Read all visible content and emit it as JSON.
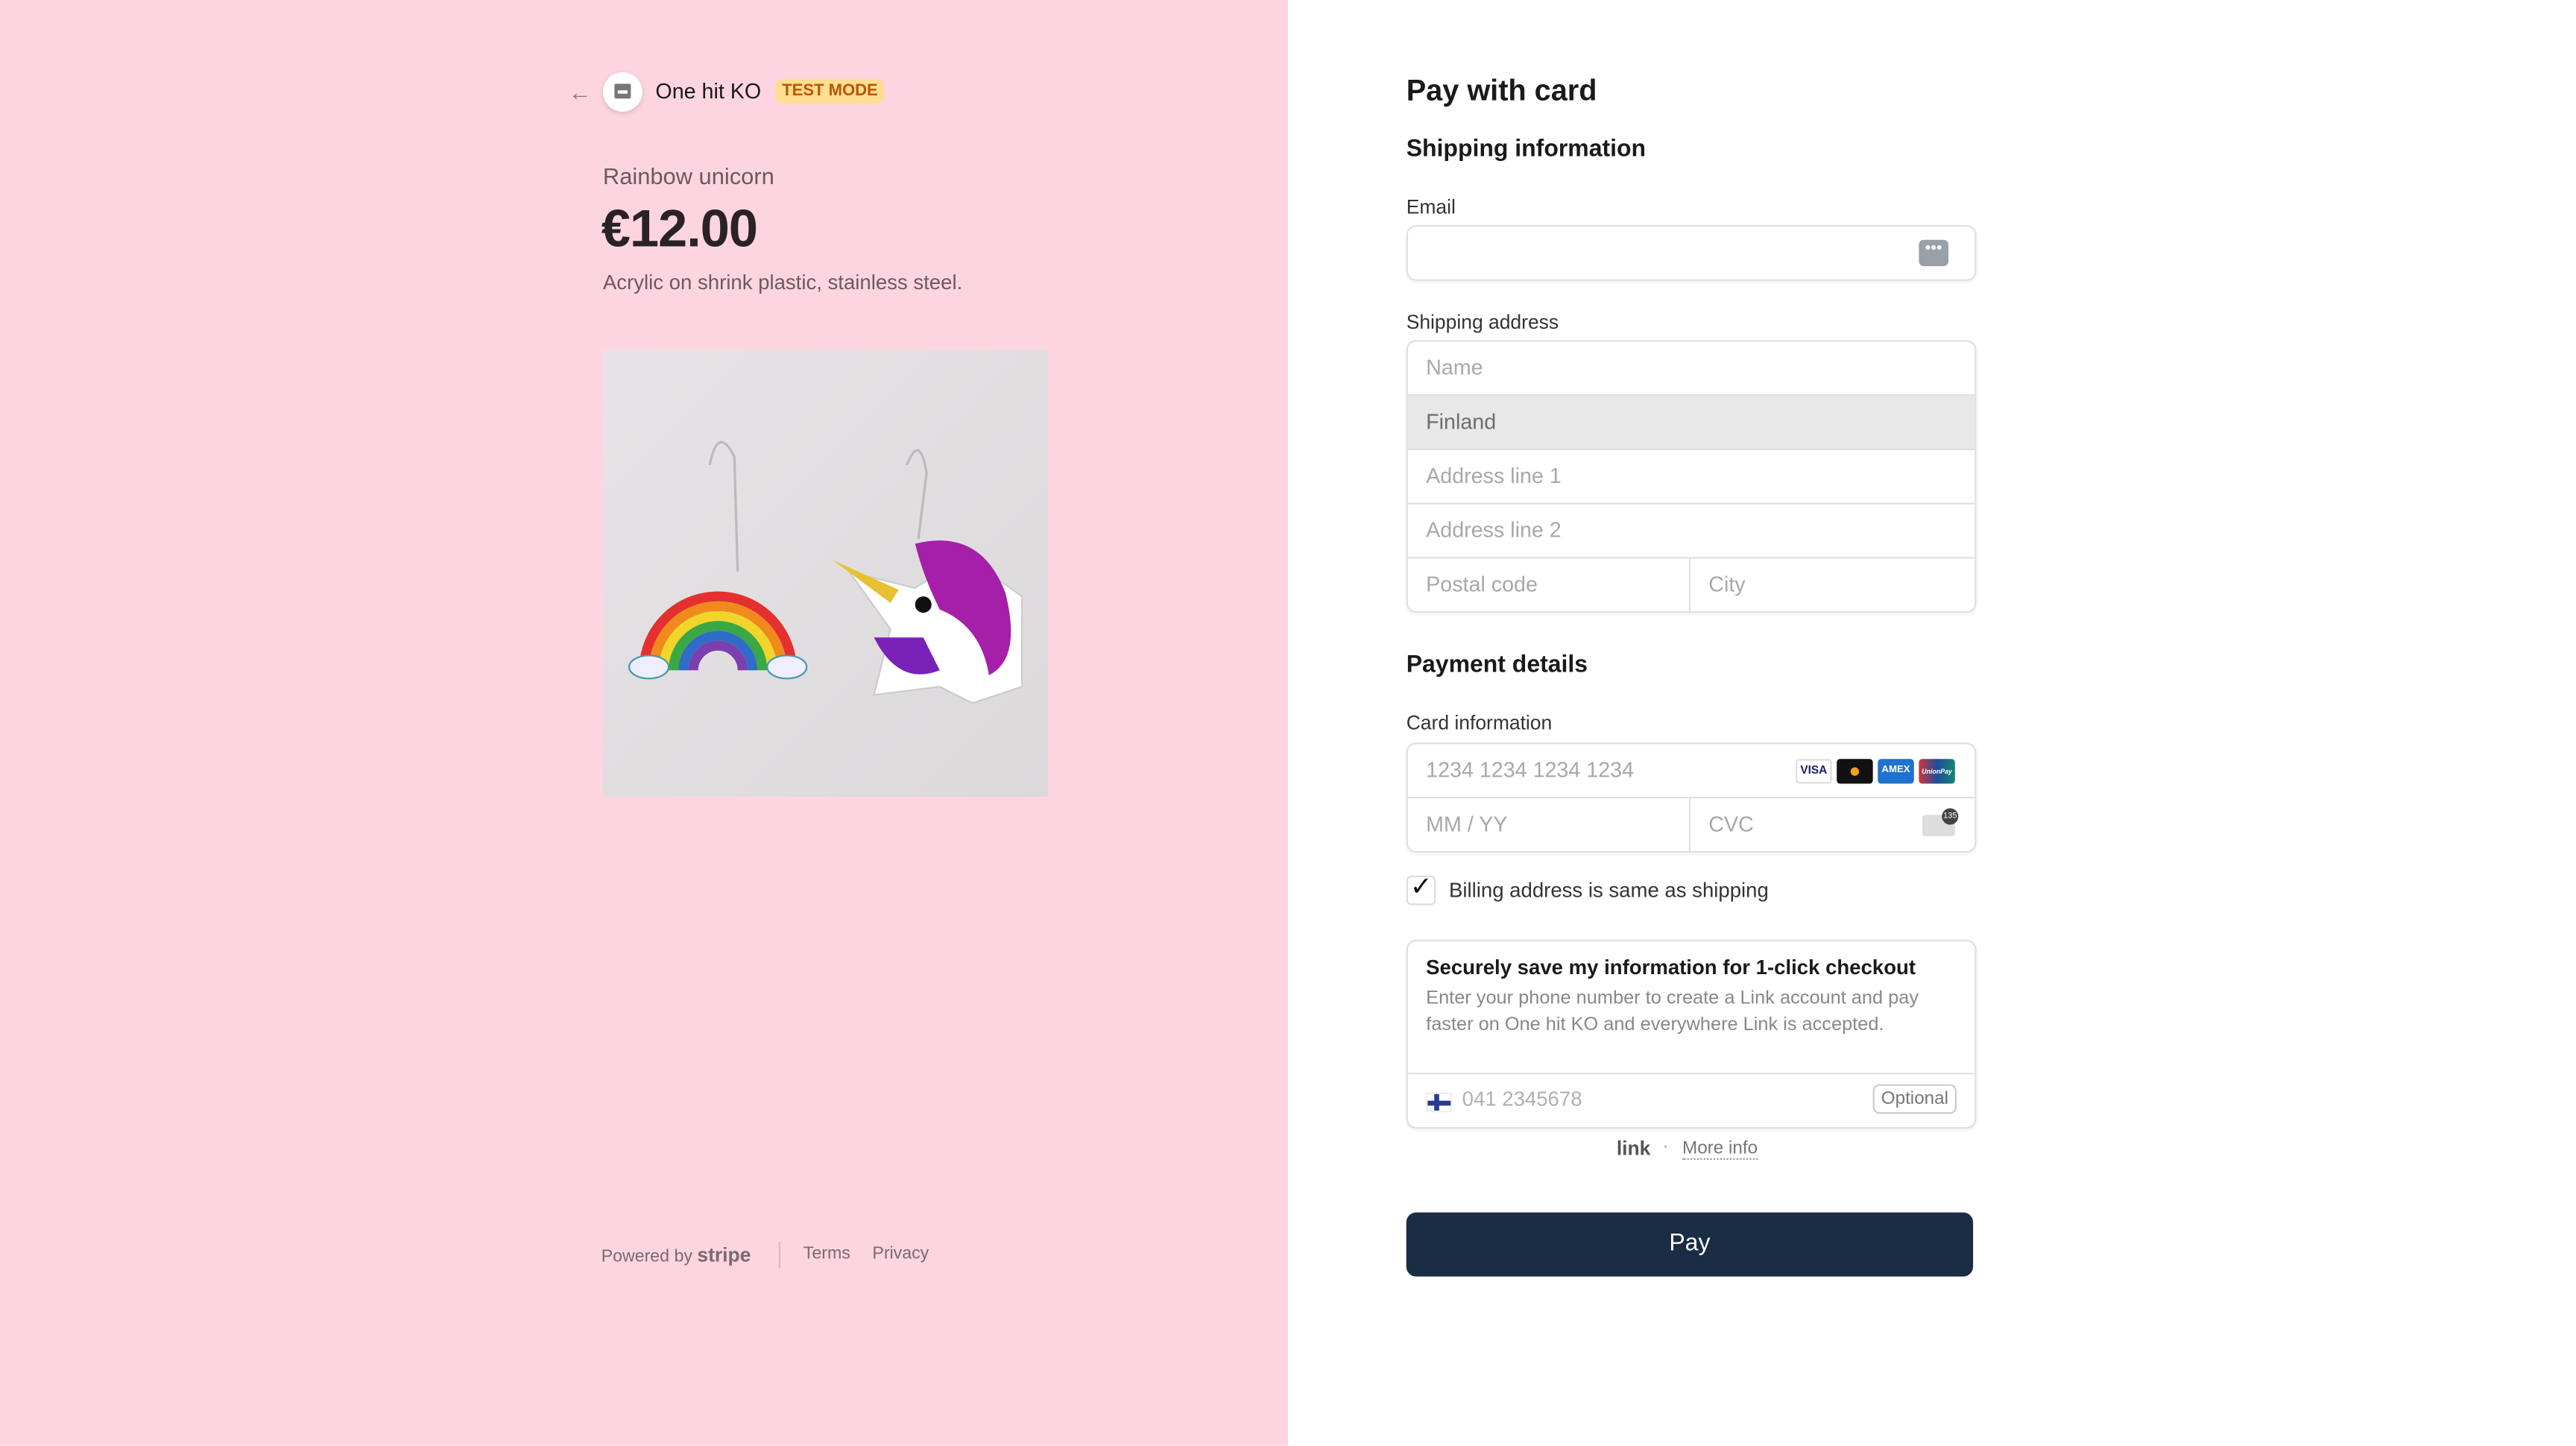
{
  "merchant": {
    "back_icon": "arrow-left-icon",
    "logo_icon": "store-icon",
    "name": "One hit KO",
    "badge": "TEST MODE"
  },
  "product": {
    "name": "Rainbow unicorn",
    "price": "€12.00",
    "description": "Acrylic on shrink plastic, stainless steel."
  },
  "footer": {
    "powered_by": "Powered by",
    "brand": "stripe",
    "terms": "Terms",
    "privacy": "Privacy"
  },
  "form": {
    "title": "Pay with card",
    "shipping_heading": "Shipping information",
    "email_label": "Email",
    "email_value": "",
    "shipping_label": "Shipping address",
    "name_placeholder": "Name",
    "country": "Finland",
    "address1_placeholder": "Address line 1",
    "address2_placeholder": "Address line 2",
    "postal_placeholder": "Postal code",
    "city_placeholder": "City",
    "payment_heading": "Payment details",
    "card_label": "Card information",
    "card_placeholder": "1234 1234 1234 1234",
    "card_brands": [
      "VISA",
      "MC",
      "AMEX",
      "UnionPay"
    ],
    "expiry_placeholder": "MM / YY",
    "cvc_placeholder": "CVC",
    "cvc_hint": "135",
    "billing_same": "Billing address is same as shipping",
    "billing_checked": true,
    "link_title": "Securely save my information for 1-click checkout",
    "link_desc": "Enter your phone number to create a Link account and pay faster on One hit KO and everywhere Link is accepted.",
    "phone_placeholder": "041 2345678",
    "optional": "Optional",
    "link_logo": "link",
    "more_info": "More info",
    "pay": "Pay"
  },
  "colors": {
    "left_bg": "#fdd5e0",
    "pay_button": "#1b2d45",
    "badge_bg": "#ffde92",
    "badge_text": "#bb5504"
  }
}
